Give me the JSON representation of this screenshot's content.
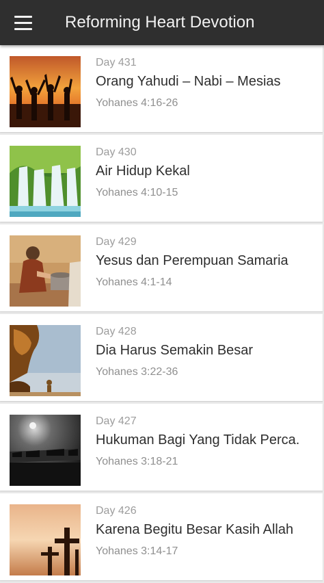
{
  "header": {
    "title": "Reforming Heart Devotion",
    "menu_icon": "hamburger-menu-icon",
    "background": "#2f2f2f"
  },
  "devotions": [
    {
      "day": "Day 431",
      "title": "Orang Yahudi – Nabi – Mesias",
      "reference": "Yohanes 4:16-26",
      "image": "people-sunset-image"
    },
    {
      "day": "Day 430",
      "title": "Air Hidup Kekal",
      "reference": "Yohanes 4:10-15",
      "image": "waterfall-image"
    },
    {
      "day": "Day 429",
      "title": "Yesus dan Perempuan Samaria",
      "reference": "Yohanes 4:1-14",
      "image": "jesus-samaritan-woman-image"
    },
    {
      "day": "Day 428",
      "title": "Dia Harus Semakin Besar",
      "reference": "Yohanes 3:22-36",
      "image": "lion-image"
    },
    {
      "day": "Day 427",
      "title": "Hukuman Bagi Yang Tidak Perca.",
      "reference": "Yohanes 3:18-21",
      "image": "dark-sky-image"
    },
    {
      "day": "Day 426",
      "title": "Karena Begitu Besar Kasih Allah",
      "reference": "Yohanes 3:14-17",
      "image": "crosses-sunset-image"
    }
  ]
}
